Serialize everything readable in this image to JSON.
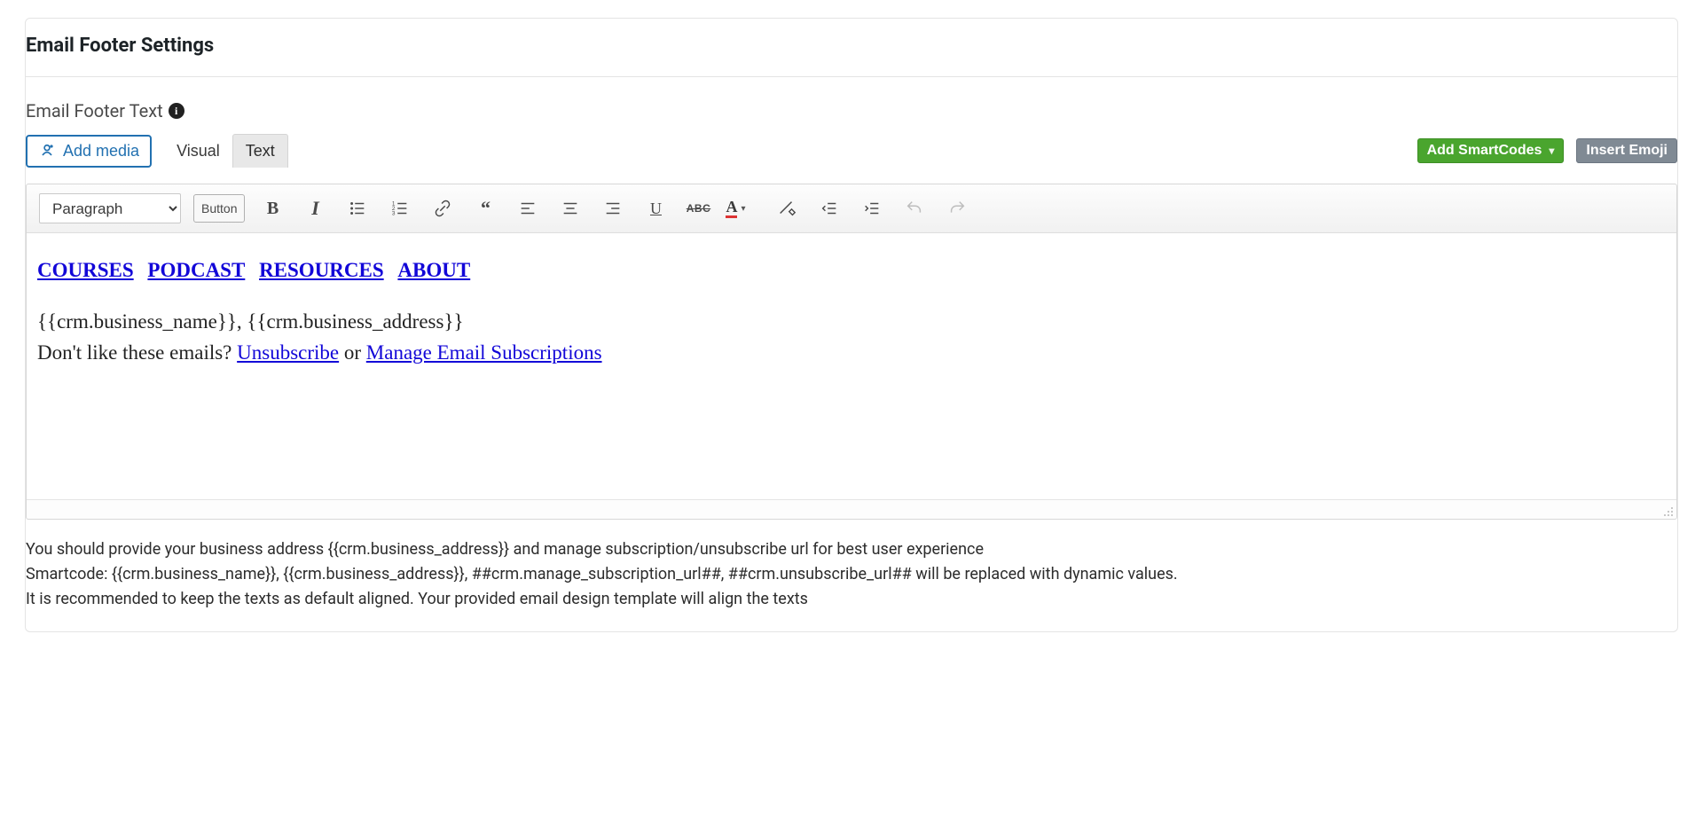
{
  "panel": {
    "title": "Email Footer Settings"
  },
  "section": {
    "label": "Email Footer Text"
  },
  "buttons": {
    "add_media": "Add media",
    "smartcodes": "Add SmartCodes",
    "insert_emoji": "Insert Emoji"
  },
  "tabs": {
    "visual": "Visual",
    "text": "Text"
  },
  "toolbar": {
    "format_value": "Paragraph",
    "button_label": "Button"
  },
  "editor": {
    "nav": [
      "COURSES",
      "PODCAST",
      "RESOURCES",
      "ABOUT"
    ],
    "line1": "{{crm.business_name}}, {{crm.business_address}}",
    "line2_pre": "Don't like these emails? ",
    "unsubscribe": "Unsubscribe",
    "or": " or ",
    "manage": "Manage Email Subscriptions"
  },
  "help": {
    "l1": "You should provide your business address {{crm.business_address}} and manage subscription/unsubscribe url for best user experience",
    "l2": "Smartcode: {{crm.business_name}}, {{crm.business_address}}, ##crm.manage_subscription_url##, ##crm.unsubscribe_url## will be replaced with dynamic values.",
    "l3": "It is recommended to keep the texts as default aligned. Your provided email design template will align the texts"
  }
}
